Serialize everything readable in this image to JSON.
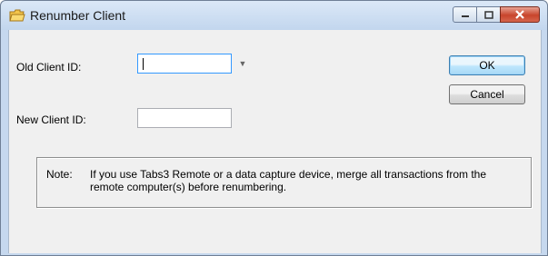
{
  "window": {
    "title": "Renumber Client",
    "icon": "folder-icon",
    "controls": [
      "minimize-icon",
      "maximize-icon",
      "close-icon"
    ]
  },
  "form": {
    "old_client_id_label": "Old Client ID:",
    "old_client_id_value": "",
    "new_client_id_label": "New Client ID:",
    "new_client_id_value": ""
  },
  "buttons": {
    "ok_label": "OK",
    "cancel_label": "Cancel"
  },
  "note": {
    "label": "Note:",
    "text": "If you use Tabs3 Remote or a data capture device, merge all transactions from the remote computer(s) before renumbering."
  },
  "colors": {
    "title_bar": "#c2d6ee",
    "close_button": "#c8452c",
    "default_button_border": "#3c7fb1"
  }
}
